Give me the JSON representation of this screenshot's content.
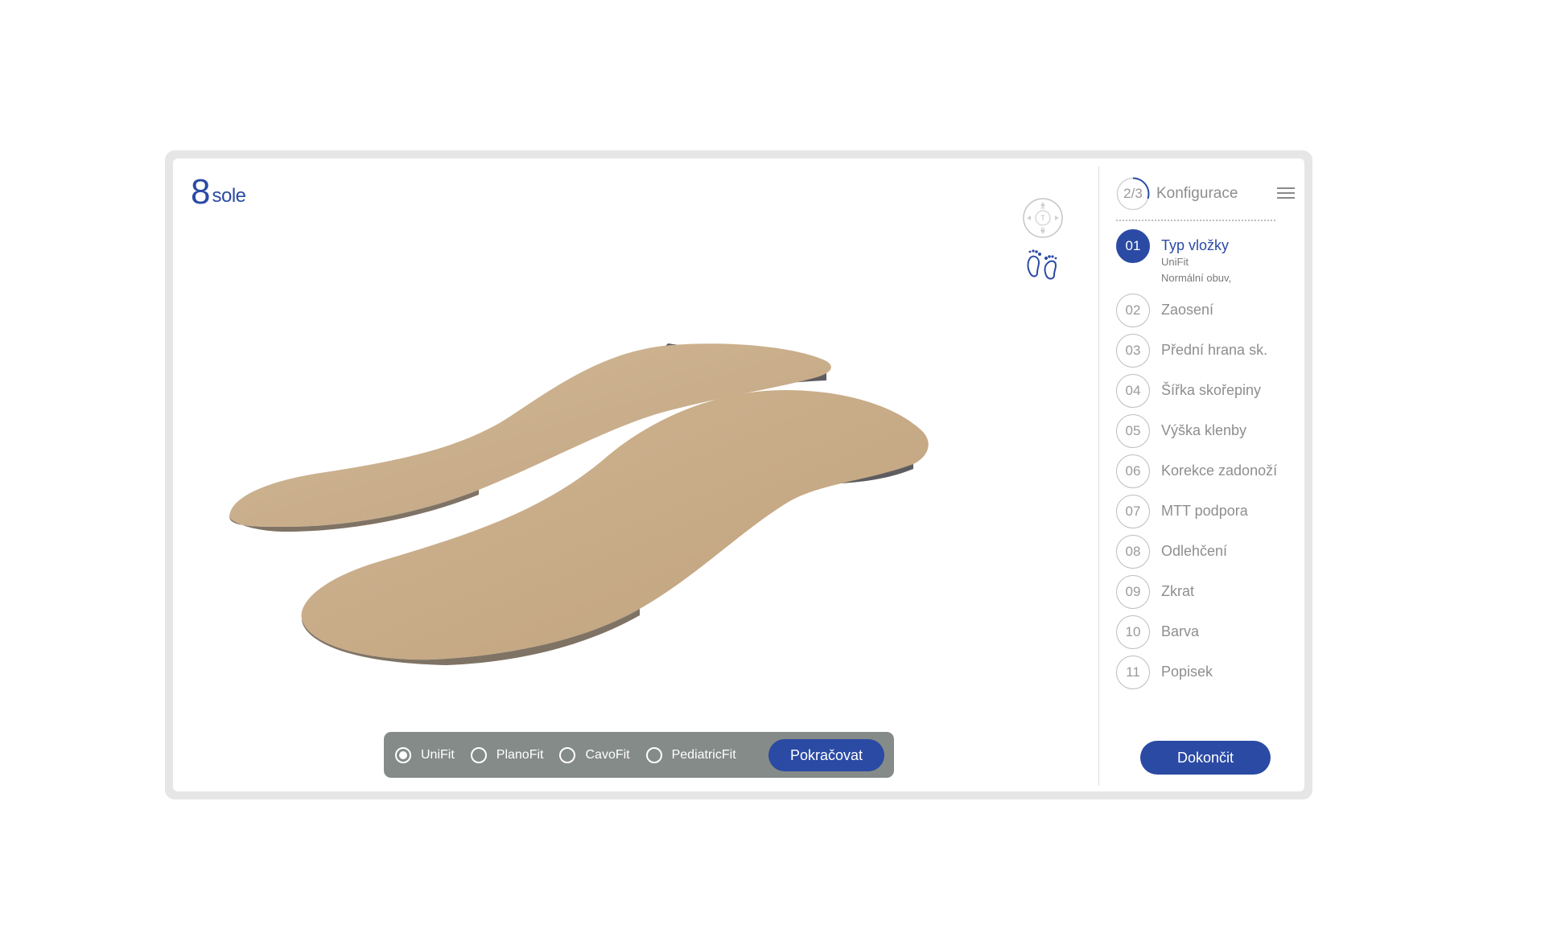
{
  "brand": {
    "mark": "8",
    "name": "sole",
    "color": "#2a4aa4"
  },
  "view_tools": {
    "compass_letters": [
      "A",
      "T",
      "P"
    ],
    "compass_icon": "view-compass-icon",
    "feet_icon": "feet-icon"
  },
  "insole_types": {
    "options": [
      {
        "label": "UniFit",
        "selected": true
      },
      {
        "label": "PlanoFit",
        "selected": false
      },
      {
        "label": "CavoFit",
        "selected": false
      },
      {
        "label": "PediatricFit",
        "selected": false
      }
    ],
    "continue_label": "Pokračovat"
  },
  "panel": {
    "progress": "2/3",
    "title": "Konfigurace",
    "steps": [
      {
        "number": "01",
        "label": "Typ vložky",
        "active": true,
        "details": [
          "UniFit",
          "Normální obuv,"
        ]
      },
      {
        "number": "02",
        "label": "Zaosení"
      },
      {
        "number": "03",
        "label": "Přední hrana sk."
      },
      {
        "number": "04",
        "label": "Šířka skořepiny"
      },
      {
        "number": "05",
        "label": "Výška klenby"
      },
      {
        "number": "06",
        "label": "Korekce zadonoží"
      },
      {
        "number": "07",
        "label": "MTT podpora"
      },
      {
        "number": "08",
        "label": "Odlehčení"
      },
      {
        "number": "09",
        "label": "Zkrat"
      },
      {
        "number": "10",
        "label": "Barva"
      },
      {
        "number": "11",
        "label": "Popisek"
      }
    ],
    "finish_label": "Dokončit"
  },
  "colors": {
    "accent": "#2a4aa4",
    "bar": "#858b88",
    "insole_top": "#c8ad8a",
    "insole_shell": "#6c6c6e"
  }
}
